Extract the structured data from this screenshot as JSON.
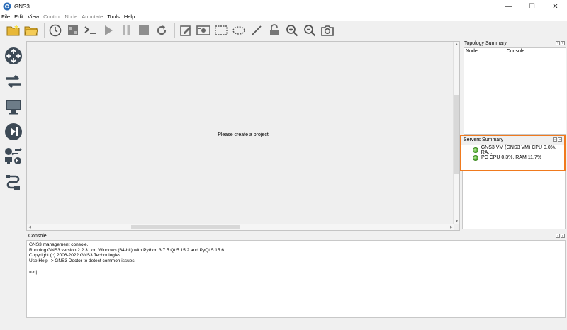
{
  "window": {
    "title": "GNS3",
    "minimize": "—",
    "maximize": "☐",
    "close": "✕"
  },
  "menu": {
    "items": [
      {
        "label": "File",
        "enabled": true
      },
      {
        "label": "Edit",
        "enabled": true
      },
      {
        "label": "View",
        "enabled": true
      },
      {
        "label": "Control",
        "enabled": false
      },
      {
        "label": "Node",
        "enabled": false
      },
      {
        "label": "Annotate",
        "enabled": false
      },
      {
        "label": "Tools",
        "enabled": true
      },
      {
        "label": "Help",
        "enabled": true
      }
    ]
  },
  "toolbar": {
    "icons": [
      "new-project-icon",
      "open-project-icon",
      "snapshot-icon",
      "show-interface-labels-icon",
      "console-all-icon",
      "start-all-icon",
      "suspend-all-icon",
      "stop-all-icon",
      "reload-all-icon",
      "add-note-icon",
      "insert-image-icon",
      "draw-rectangle-icon",
      "draw-ellipse-icon",
      "draw-line-icon",
      "lock-icon",
      "zoom-in-icon",
      "zoom-out-icon",
      "screenshot-icon"
    ]
  },
  "devices": {
    "icons": [
      "router-icon",
      "switch-icon",
      "end-device-icon",
      "security-device-icon",
      "all-devices-icon",
      "add-link-icon"
    ]
  },
  "canvas": {
    "message": "Please create a project"
  },
  "topology": {
    "title": "Topology Summary",
    "columns": [
      "Node",
      "Console"
    ]
  },
  "servers": {
    "title": "Servers Summary",
    "rows": [
      {
        "label": "GNS3 VM (GNS3 VM) CPU 0.0%, RA...",
        "status": "running"
      },
      {
        "label": "PC CPU 0.3%, RAM 11.7%",
        "status": "running"
      }
    ]
  },
  "console": {
    "title": "Console",
    "lines": [
      "GNS3 management console.",
      "Running GNS3 version 2.2.31 on Windows (64-bit) with Python 3.7.5 Qt 5.15.2 and PyQt 5.15.6.",
      "Copyright (c) 2006-2022 GNS3 Technologies.",
      "Use Help -> GNS3 Doctor to detect common issues."
    ],
    "prompt": "=> |"
  },
  "colors": {
    "highlight": "#f07a1e",
    "status_green": "#4fa72d"
  }
}
